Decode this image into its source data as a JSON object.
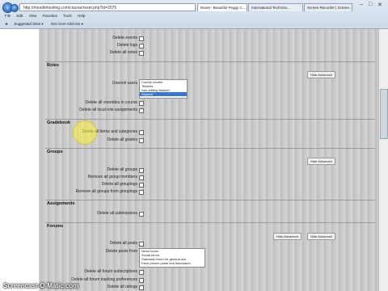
{
  "browser": {
    "address": "http://moodlehosting.com/course/reset.php?id=2075",
    "tabs": [
      "Reset - Beautiful Peggy C...",
      "International Technolo...",
      "Screen Recorder | Screen..."
    ],
    "menu": [
      "File",
      "Edit",
      "View",
      "Favorites",
      "Tools",
      "Help"
    ],
    "favorites": [
      "Suggested Sites ▾",
      "Get more Add-ons ▾"
    ]
  },
  "top_rows": [
    "Delete events",
    "Delete logs",
    "Delete all notes"
  ],
  "roles": {
    "heading": "Roles",
    "unenrol_label": "Unenrol users",
    "role_options": [
      "Course creator",
      "Teacher",
      "Non-editing teacher",
      "Student"
    ],
    "selected_role": "Student",
    "rows": [
      "Delete all overrides in course",
      "Delete all local role assignments"
    ],
    "hide_advanced": "Hide Advanced"
  },
  "gradebook": {
    "heading": "Gradebook",
    "rows": [
      "Delete all items and categories",
      "Delete all grades"
    ]
  },
  "groups": {
    "heading": "Groups",
    "rows": [
      "Delete all groups",
      "Remove all group members",
      "Delete all groupings",
      "Remove all groups from groupings"
    ],
    "hide_advanced": "Hide Advanced"
  },
  "assignments": {
    "heading": "Assignments",
    "rows": [
      "Delete all submissions"
    ]
  },
  "forums": {
    "heading": "Forums",
    "delete_all_posts": "Delete all posts",
    "delete_posts_from": "Delete posts from",
    "forum_options": [
      "News forum",
      "Social forum",
      "Standard forum for general use",
      "Each person posts one discussion"
    ],
    "rows": [
      "Delete all forum subscriptions",
      "Delete all forum tracking preferences",
      "Delete all ratings"
    ],
    "hide_advanced": "Hide Advanced"
  },
  "watermark": "Screencast-O-Matic.com"
}
